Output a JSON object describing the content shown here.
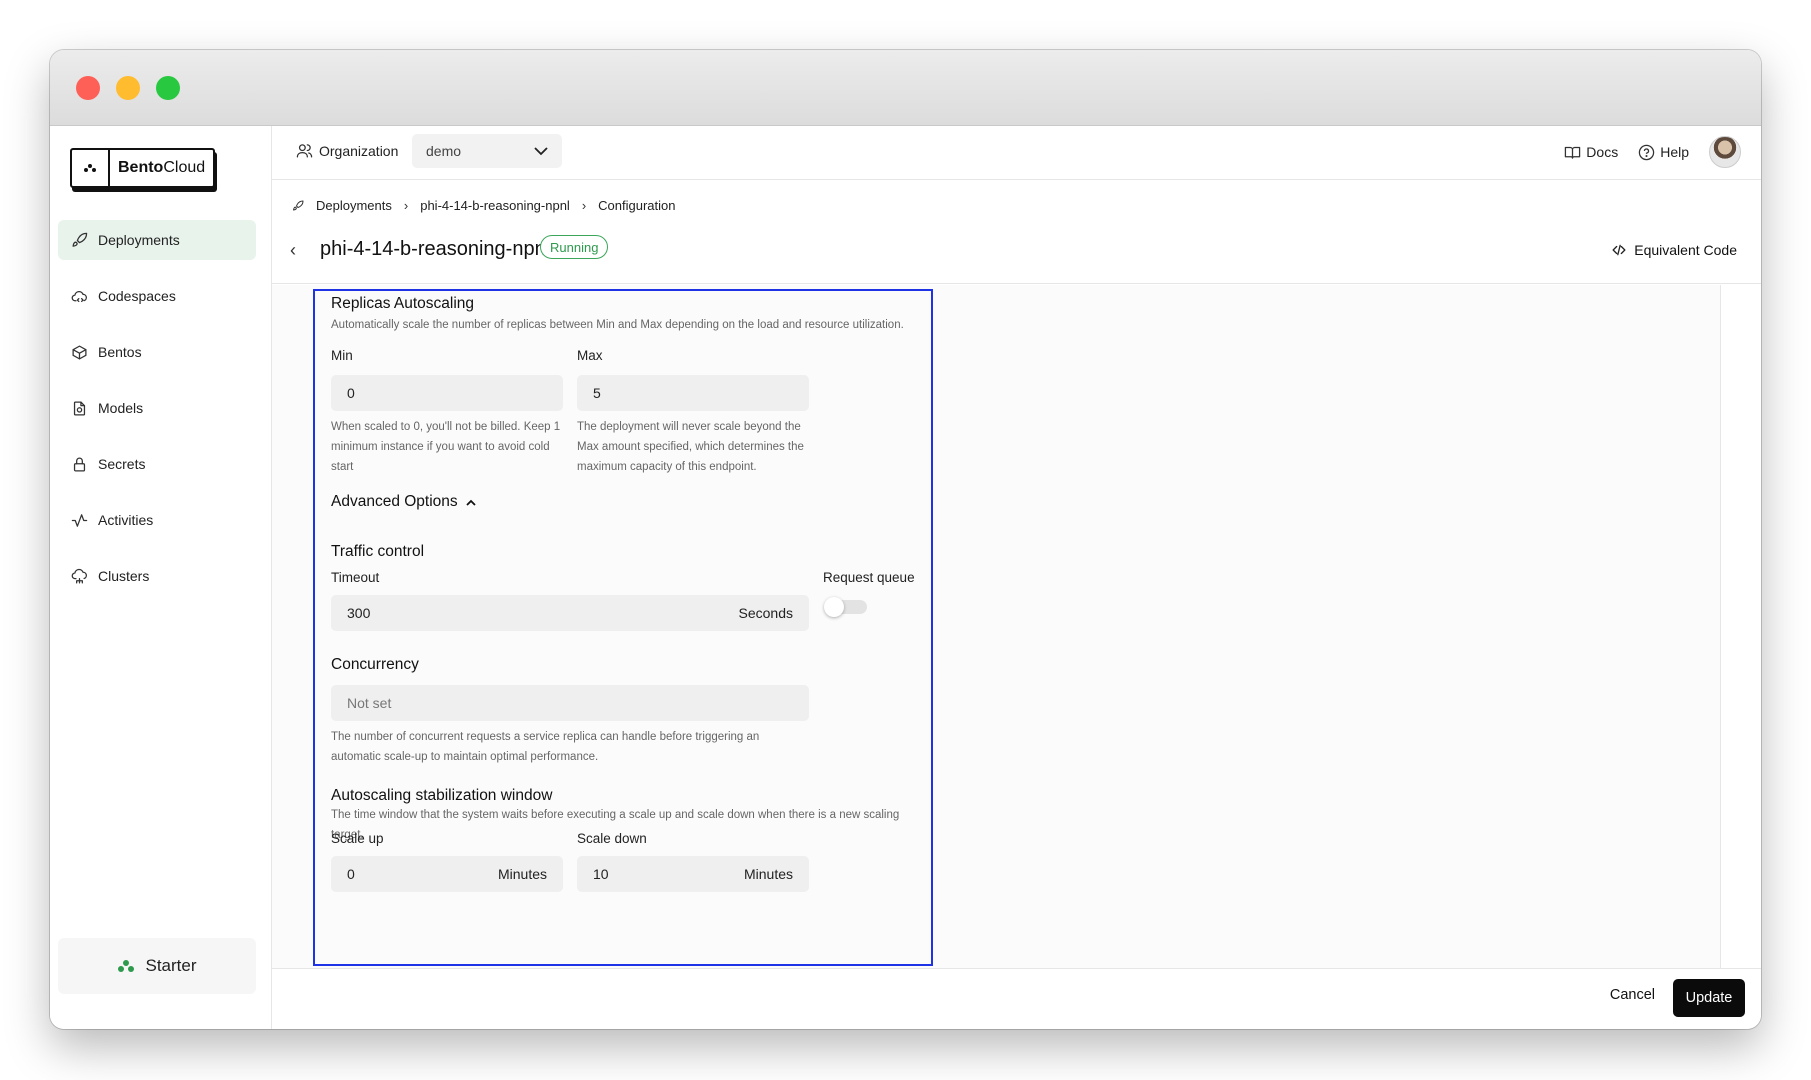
{
  "brand": {
    "name_bold": "Bento",
    "name_rest": "Cloud"
  },
  "sidebar": {
    "items": [
      {
        "label": "Deployments",
        "icon": "rocket-icon",
        "active": true
      },
      {
        "label": "Codespaces",
        "icon": "cloud-code-icon"
      },
      {
        "label": "Bentos",
        "icon": "box-icon"
      },
      {
        "label": "Models",
        "icon": "model-file-icon"
      },
      {
        "label": "Secrets",
        "icon": "lock-icon"
      },
      {
        "label": "Activities",
        "icon": "activity-icon"
      },
      {
        "label": "Clusters",
        "icon": "cluster-cloud-icon"
      }
    ],
    "plan_label": "Starter",
    "collapse_glyph": "«"
  },
  "topbar": {
    "org_label": "Organization",
    "org_value": "demo",
    "docs_label": "Docs",
    "help_label": "Help"
  },
  "breadcrumb": [
    "Deployments",
    "phi-4-14-b-reasoning-npnl",
    "Configuration"
  ],
  "page": {
    "title": "phi-4-14-b-reasoning-npnl",
    "status": "Running",
    "equivalent_code_label": "Equivalent Code"
  },
  "autoscaling": {
    "title": "Replicas Autoscaling",
    "description": "Automatically scale the number of replicas between Min and Max depending on the load and resource utilization.",
    "min_label": "Min",
    "min_value": "0",
    "min_help": "When scaled to 0, you'll not be billed. Keep 1 minimum instance if you want to avoid cold start",
    "max_label": "Max",
    "max_value": "5",
    "max_help": "The deployment will never scale beyond the Max amount specified, which determines the maximum capacity of this endpoint."
  },
  "advanced": {
    "label": "Advanced Options",
    "expanded": true
  },
  "traffic": {
    "title": "Traffic control",
    "timeout_label": "Timeout",
    "timeout_value": "300",
    "timeout_unit": "Seconds",
    "queue_label": "Request queue",
    "queue_enabled": false
  },
  "concurrency": {
    "title": "Concurrency",
    "placeholder": "Not set",
    "help": "The number of concurrent requests a service replica can handle before triggering an automatic scale-up to maintain optimal performance."
  },
  "stabilization": {
    "title": "Autoscaling stabilization window",
    "description": "The time window that the system waits before executing a scale up and scale down when there is a new scaling target.",
    "scale_up_label": "Scale up",
    "scale_up_value": "0",
    "scale_up_unit": "Minutes",
    "scale_down_label": "Scale down",
    "scale_down_value": "10",
    "scale_down_unit": "Minutes"
  },
  "footer": {
    "cancel_label": "Cancel",
    "update_label": "Update"
  },
  "colors": {
    "accent_green": "#3aa65a",
    "focus_outline": "#1f33e6",
    "primary_button": "#0b0b0b"
  }
}
